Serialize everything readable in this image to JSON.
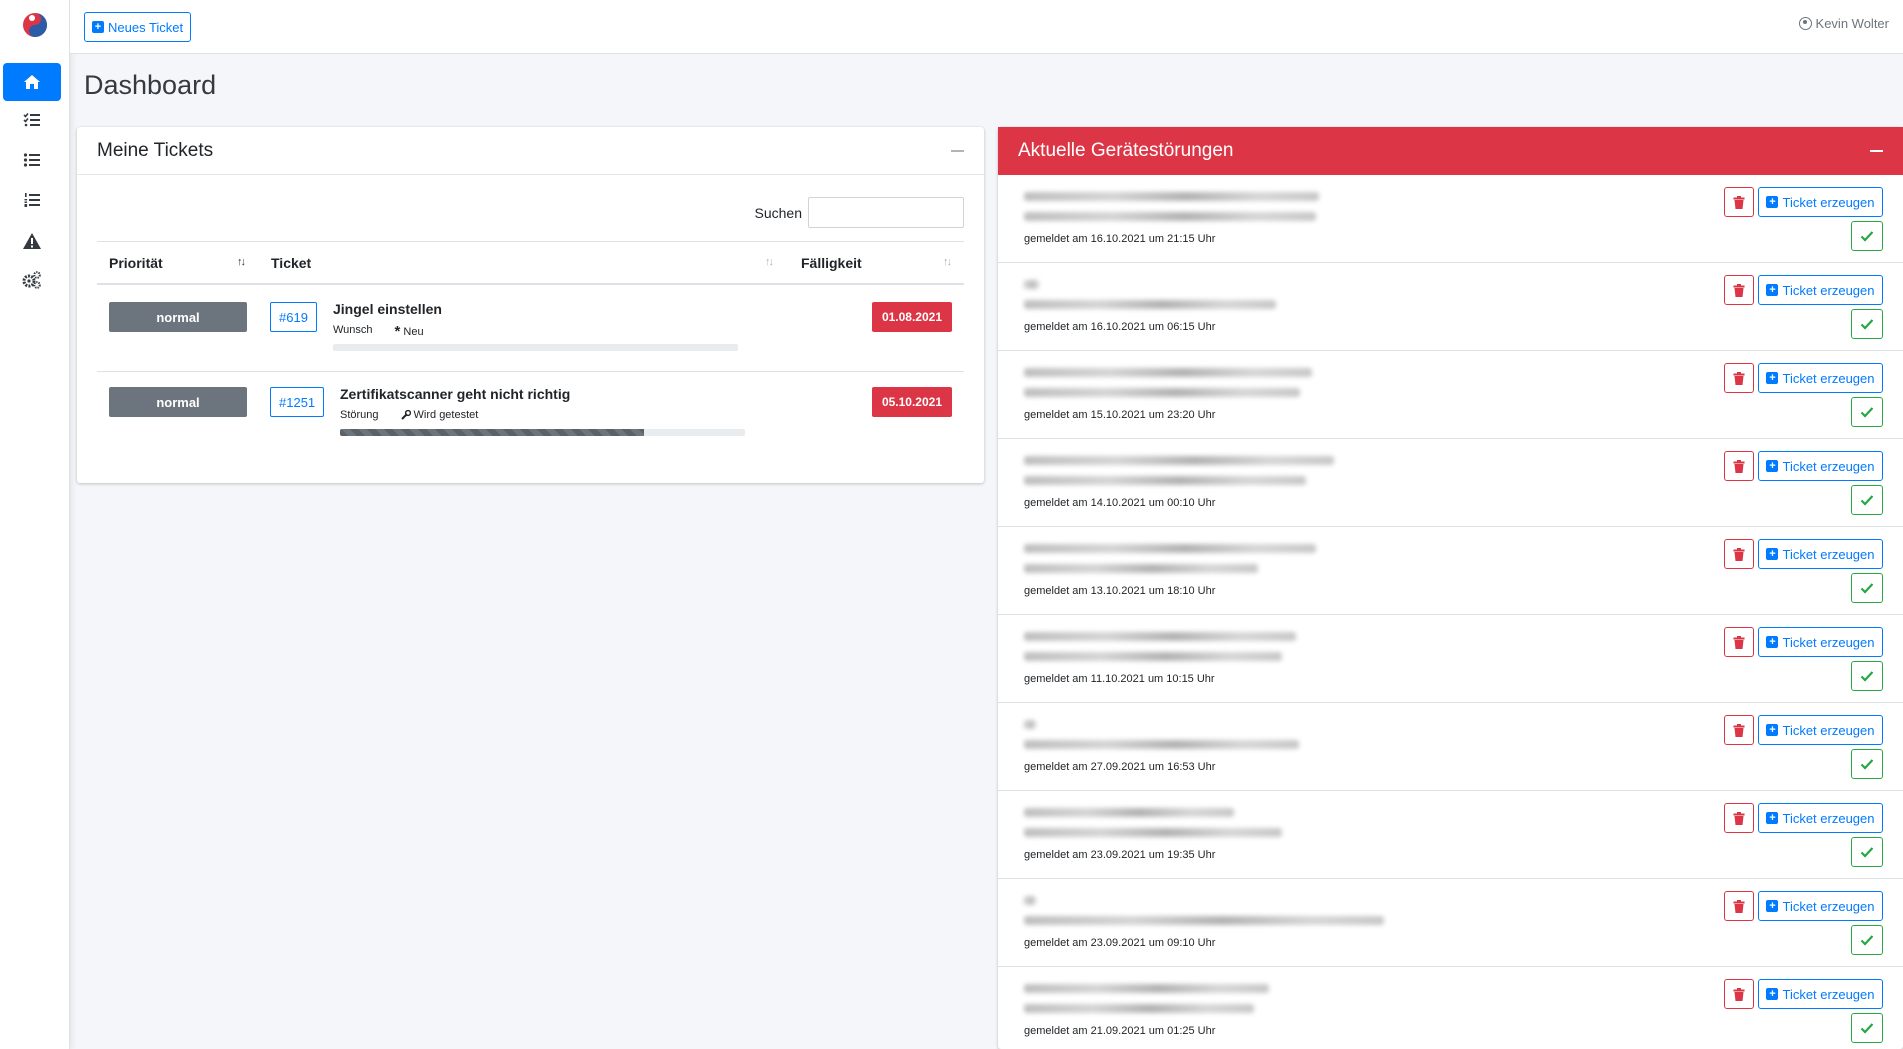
{
  "colors": {
    "primary": "#007bff",
    "danger": "#dc3545",
    "success": "#28a745",
    "secondary": "#6c757d"
  },
  "topbar": {
    "new_ticket_label": "Neues Ticket",
    "user_name": "Kevin Wolter"
  },
  "sidebar": {
    "items": [
      "home-icon",
      "tasks-list-icon",
      "list-icon",
      "ordered-list-icon",
      "warning-icon",
      "cogs-icon"
    ]
  },
  "page": {
    "title": "Dashboard"
  },
  "tickets_card": {
    "title": "Meine Tickets",
    "search_label": "Suchen",
    "columns": [
      "Priorität",
      "Ticket",
      "Fälligkeit"
    ],
    "rows": [
      {
        "priority": "normal",
        "id": "#619",
        "title": "Jingel einstellen",
        "type": "Wunsch",
        "status": "Neu",
        "progress": 0,
        "due": "01.08.2021"
      },
      {
        "priority": "normal",
        "id": "#1251",
        "title": "Zertifikatscanner geht nicht richtig",
        "type": "Störung",
        "status": "Wird getestet",
        "progress": 75,
        "due": "05.10.2021"
      }
    ]
  },
  "faults_card": {
    "title": "Aktuelle Gerätestörungen",
    "ticket_button_label": "Ticket erzeugen",
    "items": [
      {
        "reported": "gemeldet am 16.10.2021 um 21:15 Uhr"
      },
      {
        "reported": "gemeldet am 16.10.2021 um 06:15 Uhr"
      },
      {
        "reported": "gemeldet am 15.10.2021 um 23:20 Uhr"
      },
      {
        "reported": "gemeldet am 14.10.2021 um 00:10 Uhr"
      },
      {
        "reported": "gemeldet am 13.10.2021 um 18:10 Uhr"
      },
      {
        "reported": "gemeldet am 11.10.2021 um 10:15 Uhr"
      },
      {
        "reported": "gemeldet am 27.09.2021 um 16:53 Uhr"
      },
      {
        "reported": "gemeldet am 23.09.2021 um 19:35 Uhr"
      },
      {
        "reported": "gemeldet am 23.09.2021 um 09:10 Uhr"
      },
      {
        "reported": "gemeldet am 21.09.2021 um 01:25 Uhr"
      }
    ]
  }
}
